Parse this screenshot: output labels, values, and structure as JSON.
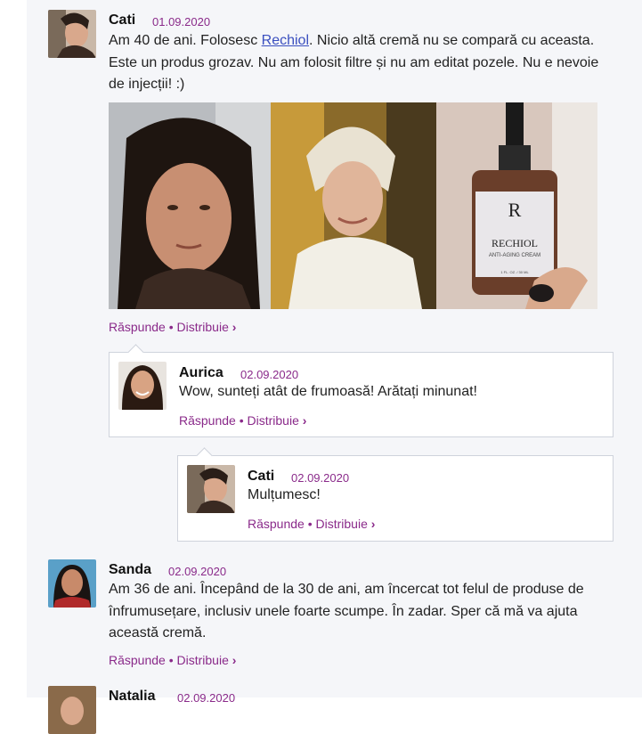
{
  "comments": [
    {
      "author": "Cati",
      "date": "01.09.2020",
      "text_before_link": "Am 40 de ani. Folosesc ",
      "link": "Rechiol",
      "text_after_link": ". Nicio altă cremă nu se compară cu aceasta. Este un produs grozav. Nu am folosit filtre și nu am editat pozele. Nu e nevoie de injecții! :)",
      "product_label": "RECHIOL",
      "product_sublabel": "ANTI-AGING CREAM",
      "product_volume": "1 FL. OZ. / 30 ML"
    },
    {
      "author": "Aurica",
      "date": "02.09.2020",
      "text": "Wow, sunteți atât de frumoasă! Arătați minunat!"
    },
    {
      "author": "Cati",
      "date": "02.09.2020",
      "text": "Mulțumesc!"
    },
    {
      "author": "Sanda",
      "date": "02.09.2020",
      "text": "Am 36 de ani. Începând de la 30 de ani, am încercat tot felul de produse de înfrumusețare, inclusiv unele foarte scumpe. În zadar. Sper că mă va ajuta această cremă."
    },
    {
      "author": "Natalia",
      "date": "02.09.2020"
    }
  ],
  "actions": {
    "reply": "Răspunde",
    "separator": "•",
    "share": "Distribuie",
    "chevron": "›"
  },
  "colors": {
    "accent": "#8a2a8a",
    "link": "#3a4fbf",
    "panel": "#f5f6f9"
  }
}
